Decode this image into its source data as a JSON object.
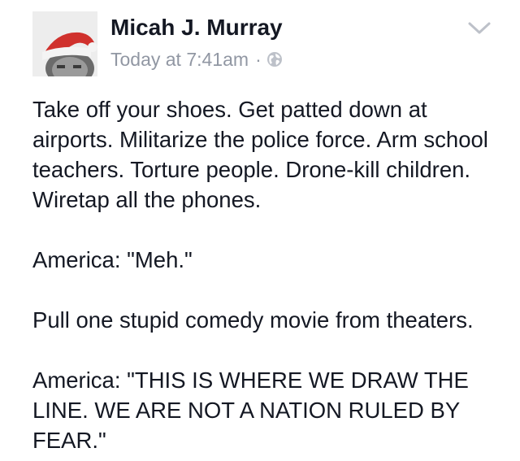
{
  "post": {
    "author": "Micah J. Murray",
    "timestamp": "Today at 7:41am",
    "separator": "·",
    "privacy_icon": "globe-icon",
    "menu_icon": "chevron-down-icon",
    "paragraphs": [
      "Take off your shoes. Get patted down at airports. Militarize the police force. Arm school teachers. Torture people. Drone-kill children. Wiretap all the phones.",
      "America: \"Meh.\"",
      "Pull one stupid comedy movie from theaters.",
      "America: \"THIS IS WHERE WE DRAW THE LINE. WE ARE NOT A NATION RULED BY FEAR.\""
    ]
  },
  "colors": {
    "text": "#141823",
    "meta": "#9197a3",
    "icon": "#bdc1c9"
  }
}
